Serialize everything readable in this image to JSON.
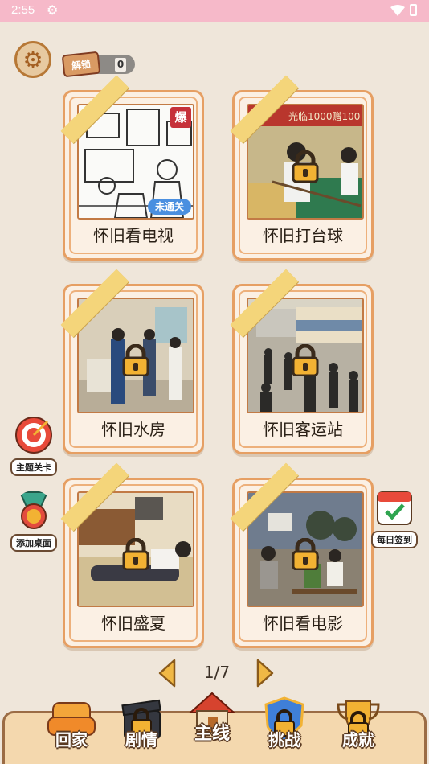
{
  "status_bar": {
    "time": "2:55"
  },
  "header": {
    "unlock_label": "解锁",
    "unlock_count": "0"
  },
  "cards": [
    {
      "title": "怀旧看电视",
      "hot_badge": "爆",
      "status_badge": "未通关",
      "locked": false
    },
    {
      "title": "怀旧打台球",
      "locked": true,
      "sign_text": "光临1000赠100"
    },
    {
      "title": "怀旧水房",
      "locked": true
    },
    {
      "title": "怀旧客运站",
      "locked": true
    },
    {
      "title": "怀旧盛夏",
      "locked": true
    },
    {
      "title": "怀旧看电影",
      "locked": true
    }
  ],
  "side_buttons": {
    "theme_level": "主题关卡",
    "add_desktop": "添加桌面",
    "daily_checkin": "每日签到"
  },
  "pager": {
    "current": "1/7"
  },
  "bottom_nav": [
    {
      "label": "回家",
      "locked": false
    },
    {
      "label": "剧情",
      "locked": true
    },
    {
      "label": "主线",
      "locked": false,
      "active": true
    },
    {
      "label": "挑战",
      "locked": true
    },
    {
      "label": "成就",
      "locked": true
    }
  ],
  "colors": {
    "background": "#efe6da",
    "status_bar": "#f6b9c9",
    "card_border": "#e69f63",
    "ribbon": "#f4d57a",
    "pager_arrow": "#d99a2d"
  }
}
